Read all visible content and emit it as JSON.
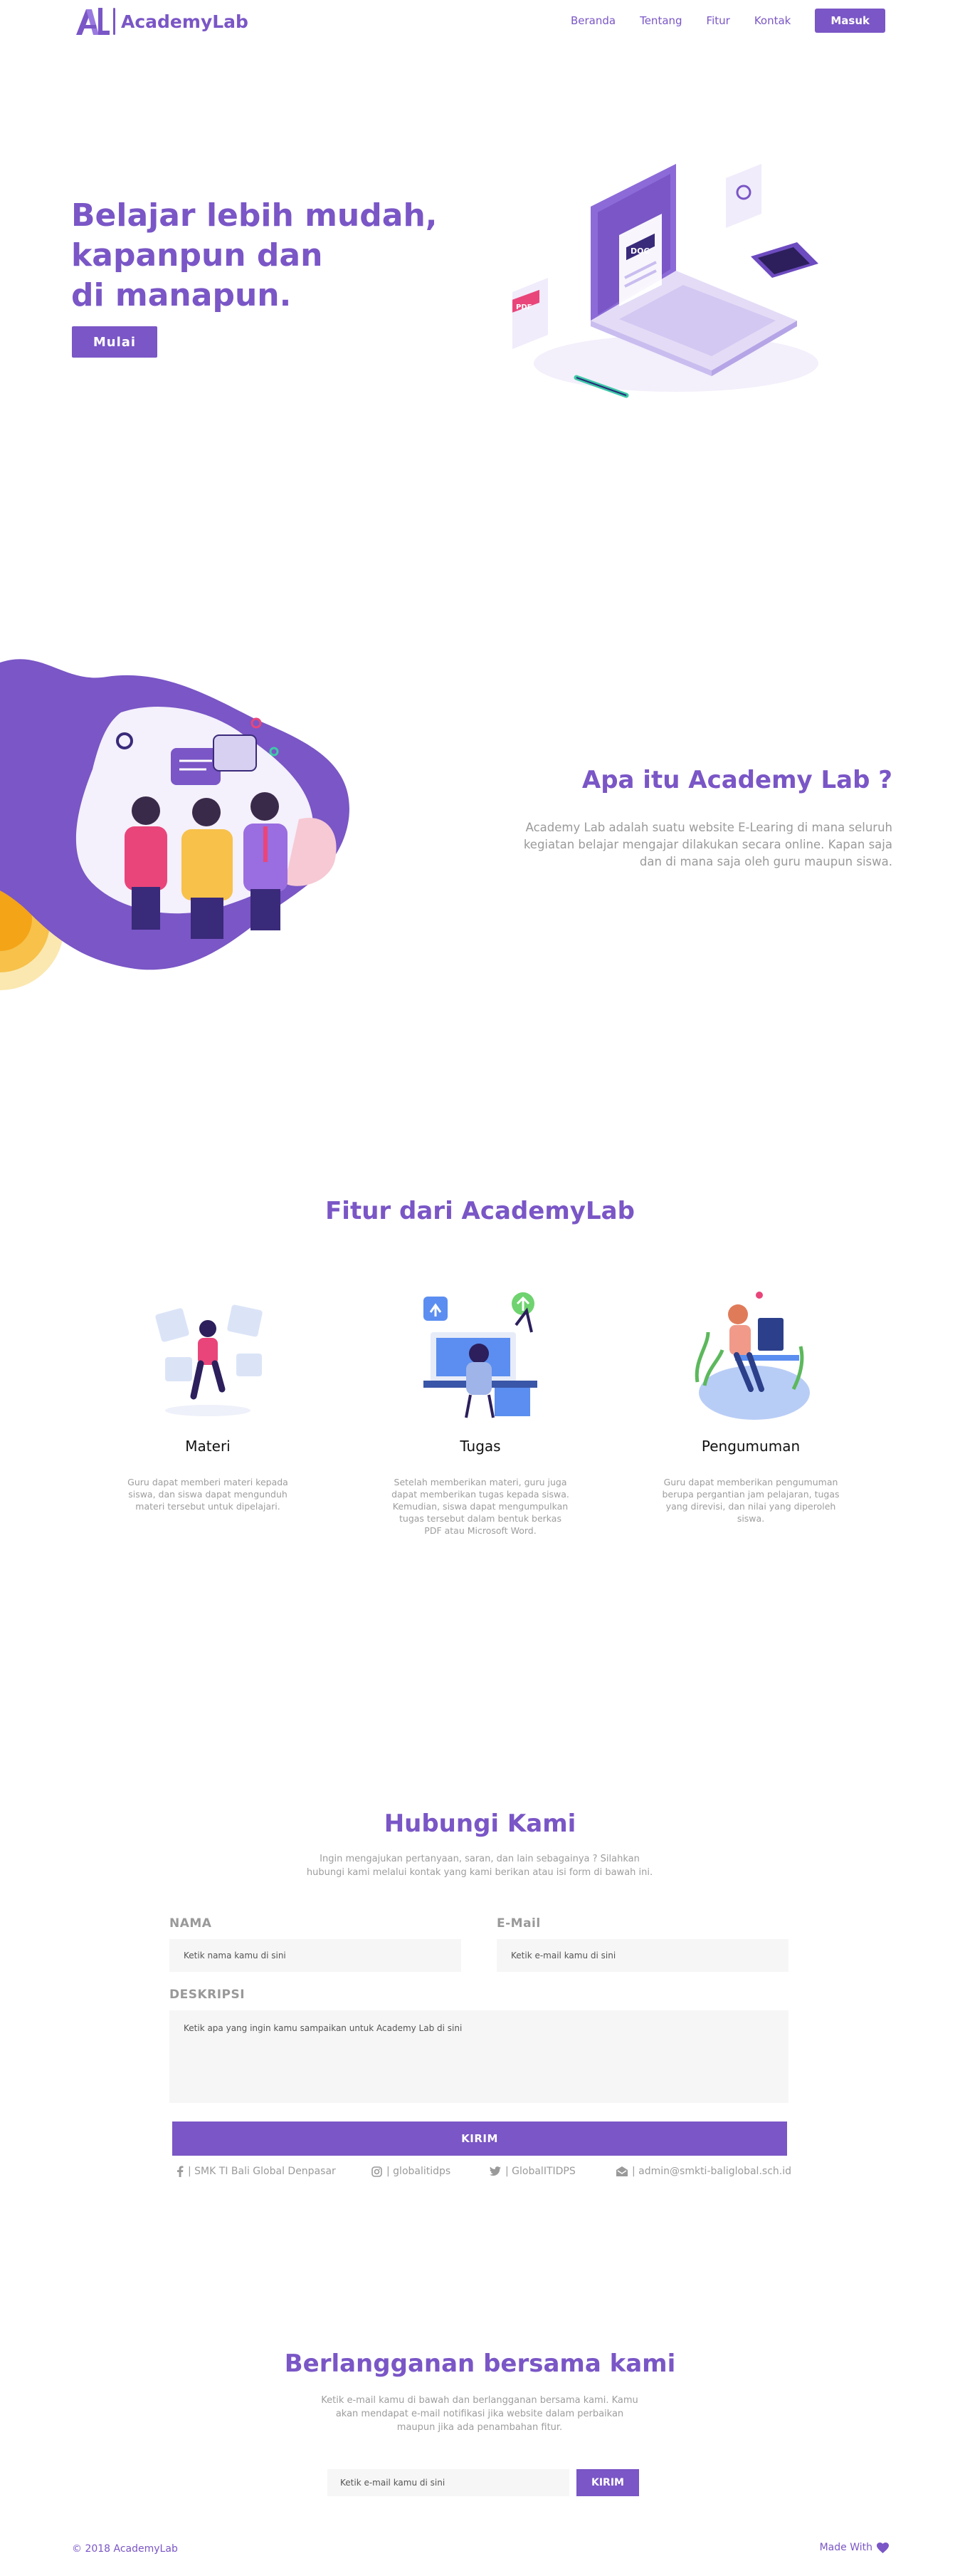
{
  "brand": {
    "name": "AcademyLab",
    "accent": "#7a56c6"
  },
  "nav": {
    "links": [
      "Beranda",
      "Tentang",
      "Fitur",
      "Kontak"
    ],
    "login_label": "Masuk"
  },
  "hero": {
    "title_line1": "Belajar lebih mudah,",
    "title_line2": "kapanpun dan",
    "title_line3": "di manapun.",
    "button_label": "Mulai",
    "illus_doc_label": "DOC",
    "illus_pdf_label": "PDF"
  },
  "about": {
    "title": "Apa itu Academy Lab ?",
    "text": "Academy Lab adalah suatu website E-Learing di mana seluruh kegiatan belajar mengajar dilakukan secara online. Kapan saja dan di mana saja oleh guru maupun siswa."
  },
  "features": {
    "title": "Fitur dari AcademyLab",
    "items": [
      {
        "name": "Materi",
        "desc": "Guru dapat memberi materi kepada siswa, dan siswa dapat mengunduh materi tersebut untuk dipelajari."
      },
      {
        "name": "Tugas",
        "desc": "Setelah memberikan materi, guru juga dapat memberikan tugas kepada siswa. Kemudian, siswa dapat mengumpulkan tugas tersebut dalam bentuk berkas PDF atau Microsoft Word."
      },
      {
        "name": "Pengumuman",
        "desc": "Guru dapat memberikan pengumuman berupa pergantian jam pelajaran, tugas yang direvisi, dan nilai yang diperoleh siswa."
      }
    ]
  },
  "contact": {
    "title": "Hubungi Kami",
    "subtitle": "Ingin mengajukan pertanyaan, saran, dan lain sebagainya ? Silahkan hubungi kami melalui kontak yang kami berikan atau isi form di bawah ini.",
    "name_label": "NAMA",
    "name_placeholder": "Ketik nama kamu di sini",
    "email_label": "E-Mail",
    "email_placeholder": "Ketik e-mail kamu di sini",
    "desc_label": "DESKRIPSI",
    "desc_placeholder": "Ketik apa yang ingin kamu sampaikan untuk Academy Lab di sini",
    "send_label": "KIRIM",
    "social": [
      {
        "icon": "facebook-icon",
        "text": "| SMK TI Bali Global Denpasar"
      },
      {
        "icon": "instagram-icon",
        "text": "| globalitidps"
      },
      {
        "icon": "twitter-icon",
        "text": "| GlobalITIDPS"
      },
      {
        "icon": "mail-icon",
        "text": "| admin@smkti-baliglobal.sch.id"
      }
    ]
  },
  "subscribe": {
    "title": "Berlangganan bersama kami",
    "text": "Ketik e-mail kamu di bawah dan berlangganan bersama kami. Kamu akan mendapat e-mail notifikasi jika website dalam perbaikan maupun jika ada penambahan fitur.",
    "placeholder": "Ketik e-mail kamu di sini",
    "button_label": "KIRIM"
  },
  "footer": {
    "copyright": "© 2018 AcademyLab",
    "made_with": "Made With"
  }
}
